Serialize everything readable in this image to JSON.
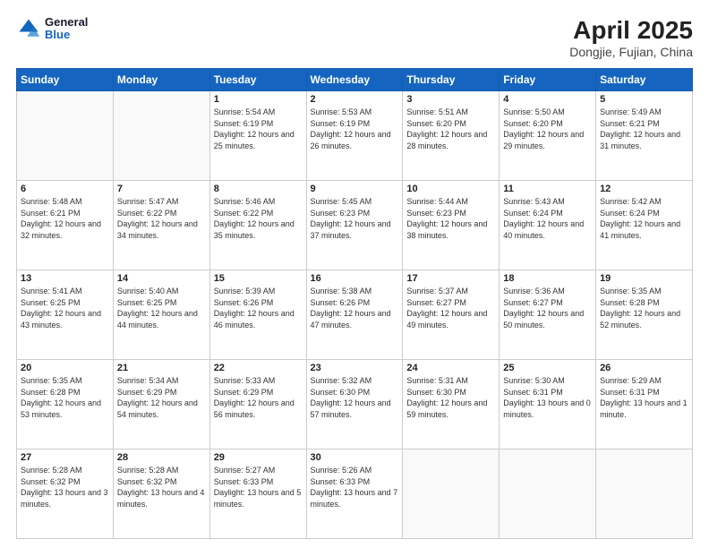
{
  "header": {
    "logo_general": "General",
    "logo_blue": "Blue",
    "title": "April 2025",
    "subtitle": "Dongjie, Fujian, China"
  },
  "days_of_week": [
    "Sunday",
    "Monday",
    "Tuesday",
    "Wednesday",
    "Thursday",
    "Friday",
    "Saturday"
  ],
  "weeks": [
    [
      {
        "day": "",
        "info": ""
      },
      {
        "day": "",
        "info": ""
      },
      {
        "day": "1",
        "info": "Sunrise: 5:54 AM\nSunset: 6:19 PM\nDaylight: 12 hours and 25 minutes."
      },
      {
        "day": "2",
        "info": "Sunrise: 5:53 AM\nSunset: 6:19 PM\nDaylight: 12 hours and 26 minutes."
      },
      {
        "day": "3",
        "info": "Sunrise: 5:51 AM\nSunset: 6:20 PM\nDaylight: 12 hours and 28 minutes."
      },
      {
        "day": "4",
        "info": "Sunrise: 5:50 AM\nSunset: 6:20 PM\nDaylight: 12 hours and 29 minutes."
      },
      {
        "day": "5",
        "info": "Sunrise: 5:49 AM\nSunset: 6:21 PM\nDaylight: 12 hours and 31 minutes."
      }
    ],
    [
      {
        "day": "6",
        "info": "Sunrise: 5:48 AM\nSunset: 6:21 PM\nDaylight: 12 hours and 32 minutes."
      },
      {
        "day": "7",
        "info": "Sunrise: 5:47 AM\nSunset: 6:22 PM\nDaylight: 12 hours and 34 minutes."
      },
      {
        "day": "8",
        "info": "Sunrise: 5:46 AM\nSunset: 6:22 PM\nDaylight: 12 hours and 35 minutes."
      },
      {
        "day": "9",
        "info": "Sunrise: 5:45 AM\nSunset: 6:23 PM\nDaylight: 12 hours and 37 minutes."
      },
      {
        "day": "10",
        "info": "Sunrise: 5:44 AM\nSunset: 6:23 PM\nDaylight: 12 hours and 38 minutes."
      },
      {
        "day": "11",
        "info": "Sunrise: 5:43 AM\nSunset: 6:24 PM\nDaylight: 12 hours and 40 minutes."
      },
      {
        "day": "12",
        "info": "Sunrise: 5:42 AM\nSunset: 6:24 PM\nDaylight: 12 hours and 41 minutes."
      }
    ],
    [
      {
        "day": "13",
        "info": "Sunrise: 5:41 AM\nSunset: 6:25 PM\nDaylight: 12 hours and 43 minutes."
      },
      {
        "day": "14",
        "info": "Sunrise: 5:40 AM\nSunset: 6:25 PM\nDaylight: 12 hours and 44 minutes."
      },
      {
        "day": "15",
        "info": "Sunrise: 5:39 AM\nSunset: 6:26 PM\nDaylight: 12 hours and 46 minutes."
      },
      {
        "day": "16",
        "info": "Sunrise: 5:38 AM\nSunset: 6:26 PM\nDaylight: 12 hours and 47 minutes."
      },
      {
        "day": "17",
        "info": "Sunrise: 5:37 AM\nSunset: 6:27 PM\nDaylight: 12 hours and 49 minutes."
      },
      {
        "day": "18",
        "info": "Sunrise: 5:36 AM\nSunset: 6:27 PM\nDaylight: 12 hours and 50 minutes."
      },
      {
        "day": "19",
        "info": "Sunrise: 5:35 AM\nSunset: 6:28 PM\nDaylight: 12 hours and 52 minutes."
      }
    ],
    [
      {
        "day": "20",
        "info": "Sunrise: 5:35 AM\nSunset: 6:28 PM\nDaylight: 12 hours and 53 minutes."
      },
      {
        "day": "21",
        "info": "Sunrise: 5:34 AM\nSunset: 6:29 PM\nDaylight: 12 hours and 54 minutes."
      },
      {
        "day": "22",
        "info": "Sunrise: 5:33 AM\nSunset: 6:29 PM\nDaylight: 12 hours and 56 minutes."
      },
      {
        "day": "23",
        "info": "Sunrise: 5:32 AM\nSunset: 6:30 PM\nDaylight: 12 hours and 57 minutes."
      },
      {
        "day": "24",
        "info": "Sunrise: 5:31 AM\nSunset: 6:30 PM\nDaylight: 12 hours and 59 minutes."
      },
      {
        "day": "25",
        "info": "Sunrise: 5:30 AM\nSunset: 6:31 PM\nDaylight: 13 hours and 0 minutes."
      },
      {
        "day": "26",
        "info": "Sunrise: 5:29 AM\nSunset: 6:31 PM\nDaylight: 13 hours and 1 minute."
      }
    ],
    [
      {
        "day": "27",
        "info": "Sunrise: 5:28 AM\nSunset: 6:32 PM\nDaylight: 13 hours and 3 minutes."
      },
      {
        "day": "28",
        "info": "Sunrise: 5:28 AM\nSunset: 6:32 PM\nDaylight: 13 hours and 4 minutes."
      },
      {
        "day": "29",
        "info": "Sunrise: 5:27 AM\nSunset: 6:33 PM\nDaylight: 13 hours and 5 minutes."
      },
      {
        "day": "30",
        "info": "Sunrise: 5:26 AM\nSunset: 6:33 PM\nDaylight: 13 hours and 7 minutes."
      },
      {
        "day": "",
        "info": ""
      },
      {
        "day": "",
        "info": ""
      },
      {
        "day": "",
        "info": ""
      }
    ]
  ]
}
